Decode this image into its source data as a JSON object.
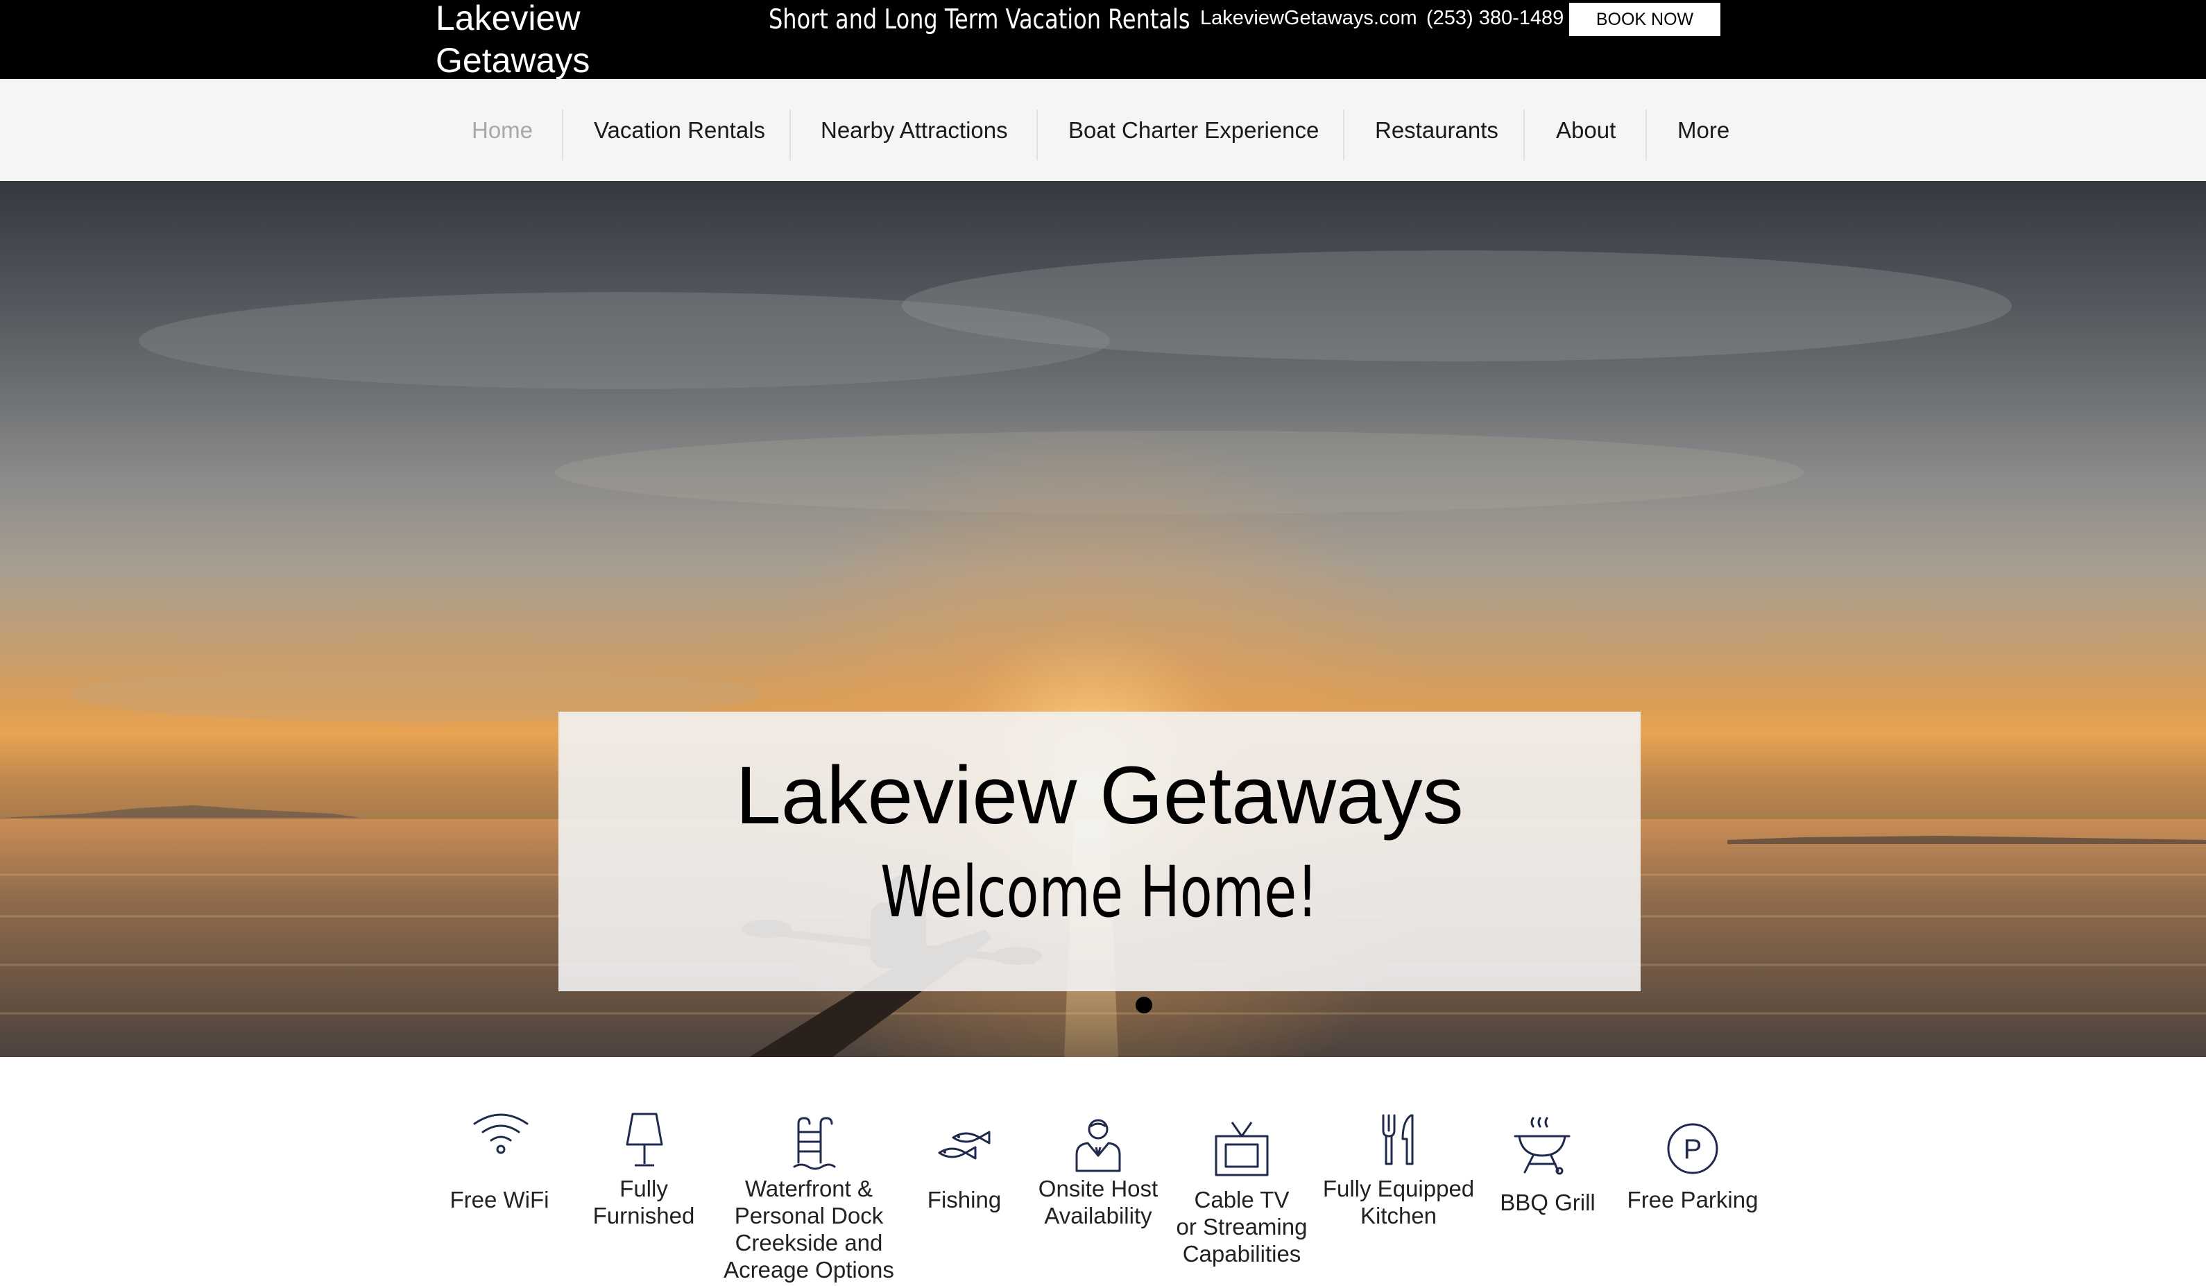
{
  "header": {
    "brand": "Lakeview\nGetaways",
    "tagline": "Short and Long Term Vacation Rentals",
    "site_url": "LakeviewGetaways.com",
    "phone": "(253) 380-1489",
    "book_now": "BOOK NOW"
  },
  "nav": {
    "items": [
      {
        "label": "Home",
        "active": true
      },
      {
        "label": "Vacation Rentals"
      },
      {
        "label": "Nearby Attractions"
      },
      {
        "label": "Boat Charter Experience"
      },
      {
        "label": "Restaurants"
      },
      {
        "label": "About"
      },
      {
        "label": "More"
      }
    ]
  },
  "hero": {
    "title": "Lakeview Getaways",
    "subtitle": "Welcome Home!",
    "slide_count": 1,
    "current_slide": 1
  },
  "amenities": [
    {
      "label": "Free WiFi",
      "icon": "wifi-icon"
    },
    {
      "label": "Fully\nFurnished",
      "icon": "lamp-icon"
    },
    {
      "label": "Waterfront &\nPersonal Dock\nCreekside and\nAcreage Options",
      "icon": "pool-ladder-icon"
    },
    {
      "label": "Fishing",
      "icon": "fish-icon"
    },
    {
      "label": "Onsite Host\nAvailability",
      "icon": "host-icon"
    },
    {
      "label": "Cable TV\nor Streaming\nCapabilities",
      "icon": "tv-icon"
    },
    {
      "label": "Fully Equipped\nKitchen",
      "icon": "fork-knife-icon"
    },
    {
      "label": "BBQ Grill",
      "icon": "bbq-grill-icon"
    },
    {
      "label": "Free Parking",
      "icon": "parking-icon"
    }
  ],
  "colors": {
    "topbar": "#000000",
    "navbar": "#f5f5f5",
    "nav_active": "#a8a8a8",
    "icon_stroke": "#1f2a4d"
  }
}
